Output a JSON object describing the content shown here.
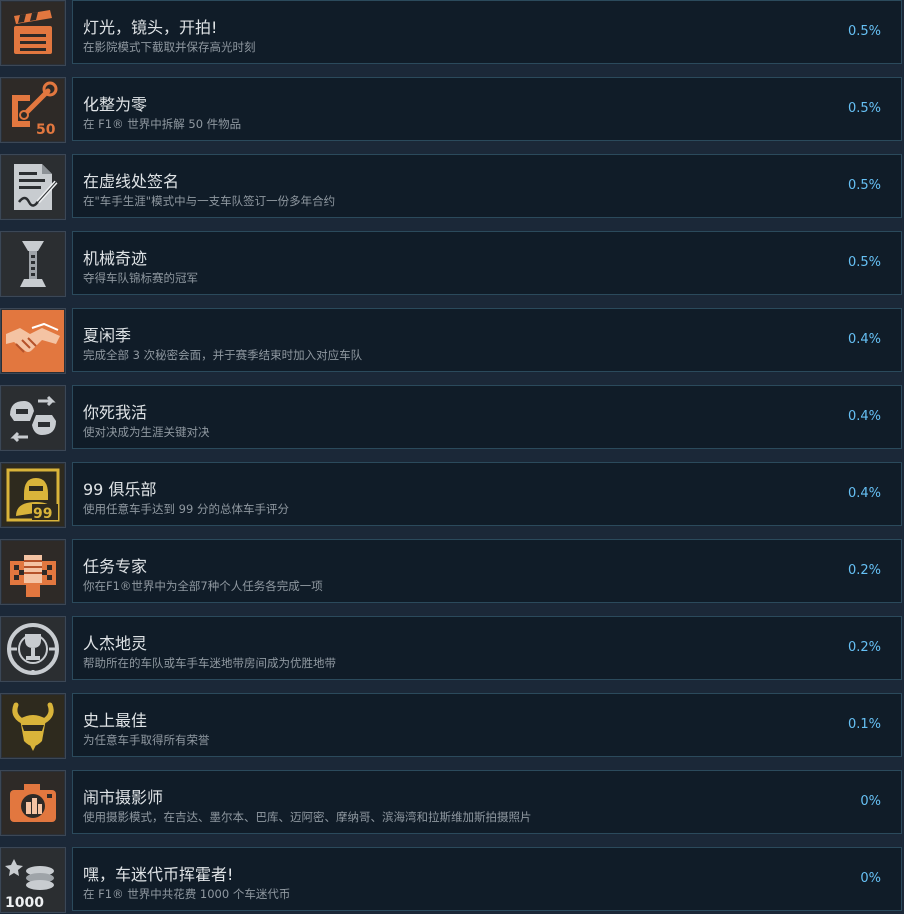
{
  "achievements": [
    {
      "title": "灯光，镜头，开拍!",
      "description": "在影院模式下截取并保存高光时刻",
      "percent": "0.5%",
      "icon": "clapperboard-icon",
      "icon_color": "#e2773f"
    },
    {
      "title": "化整为零",
      "description": "在 F1® 世界中拆解 50 件物品",
      "percent": "0.5%",
      "icon": "wrench-50-icon",
      "icon_color": "#e2773f"
    },
    {
      "title": "在虚线处签名",
      "description": "在\"车手生涯\"模式中与一支车队签订一份多年合约",
      "percent": "0.5%",
      "icon": "contract-sign-icon",
      "icon_color": "#c8ccd0"
    },
    {
      "title": "机械奇迹",
      "description": "夺得车队锦标赛的冠军",
      "percent": "0.5%",
      "icon": "trophy-spine-icon",
      "icon_color": "#c8ccd0"
    },
    {
      "title": "夏闲季",
      "description": "完成全部 3 次秘密会面，并于赛季结束时加入对应车队",
      "percent": "0.4%",
      "icon": "handshake-icon",
      "icon_color": "#e2773f"
    },
    {
      "title": "你死我活",
      "description": "使对决成为生涯关键对决",
      "percent": "0.4%",
      "icon": "helmets-duel-icon",
      "icon_color": "#c8ccd0"
    },
    {
      "title": "99 俱乐部",
      "description": "使用任意车手达到 99 分的总体车手评分",
      "percent": "0.4%",
      "icon": "driver-99-icon",
      "icon_color": "#d9b43a"
    },
    {
      "title": "任务专家",
      "description": "你在F1®世界中为全部7种个人任务各完成一项",
      "percent": "0.2%",
      "icon": "fist-flag-icon",
      "icon_color": "#e2773f"
    },
    {
      "title": "人杰地灵",
      "description": "帮助所在的车队或车手车迷地带房间成为优胜地带",
      "percent": "0.2%",
      "icon": "trophy-target-icon",
      "icon_color": "#c8ccd0"
    },
    {
      "title": "史上最佳",
      "description": "为任意车手取得所有荣誉",
      "percent": "0.1%",
      "icon": "goat-icon",
      "icon_color": "#d9b43a"
    },
    {
      "title": "闹市摄影师",
      "description": "使用摄影模式，在吉达、墨尔本、巴库、迈阿密、摩纳哥、滨海湾和拉斯维加斯拍摄照片",
      "percent": "0%",
      "icon": "camera-city-icon",
      "icon_color": "#e2773f"
    },
    {
      "title": "嘿，车迷代币挥霍者!",
      "description": "在 F1® 世界中共花费 1000 个车迷代币",
      "percent": "0%",
      "icon": "coins-1000-icon",
      "icon_color": "#c8ccd0"
    }
  ]
}
